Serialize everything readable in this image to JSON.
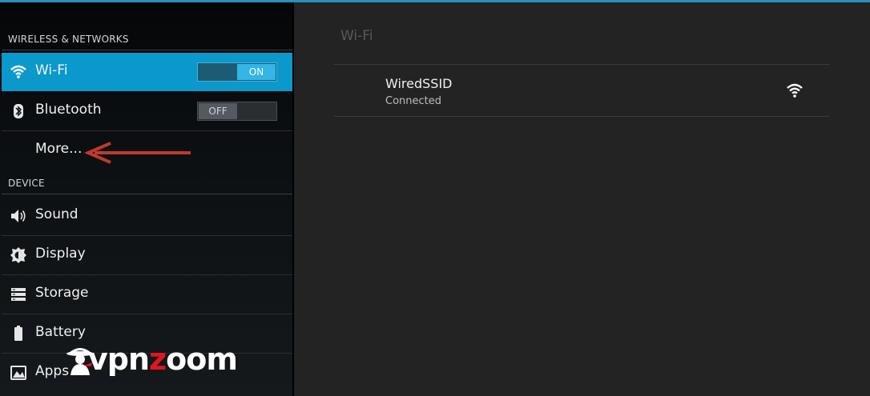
{
  "left_panel": {
    "wireless_header": "WIRELESS & NETWORKS",
    "device_header": "DEVICE",
    "items": [
      {
        "label": "Wi-Fi",
        "icon": "wifi-icon",
        "toggle": "ON",
        "selected": true
      },
      {
        "label": "Bluetooth",
        "icon": "bluetooth-icon",
        "toggle": "OFF"
      },
      {
        "label": "More...",
        "icon": null
      },
      {
        "label": "Sound",
        "icon": "speaker-icon"
      },
      {
        "label": "Display",
        "icon": "brightness-icon"
      },
      {
        "label": "Storage",
        "icon": "storage-icon"
      },
      {
        "label": "Battery",
        "icon": "battery-icon"
      },
      {
        "label": "Apps",
        "icon": "apps-icon"
      }
    ]
  },
  "right_panel": {
    "title": "Wi-Fi",
    "networks": [
      {
        "ssid": "WiredSSID",
        "status": "Connected",
        "icon": "wifi-signal-icon"
      }
    ]
  },
  "annotation": {
    "icon": "red-arrow-icon",
    "color": "#c0392b"
  },
  "watermark": {
    "text_white_1": "vpn",
    "text_red": "z",
    "text_white_2": "oom",
    "logo_icon": "hat-man-logo-icon"
  },
  "colors": {
    "accent": "#0b99cb",
    "toggle_on": "#33b5e5",
    "background": "#232323"
  }
}
